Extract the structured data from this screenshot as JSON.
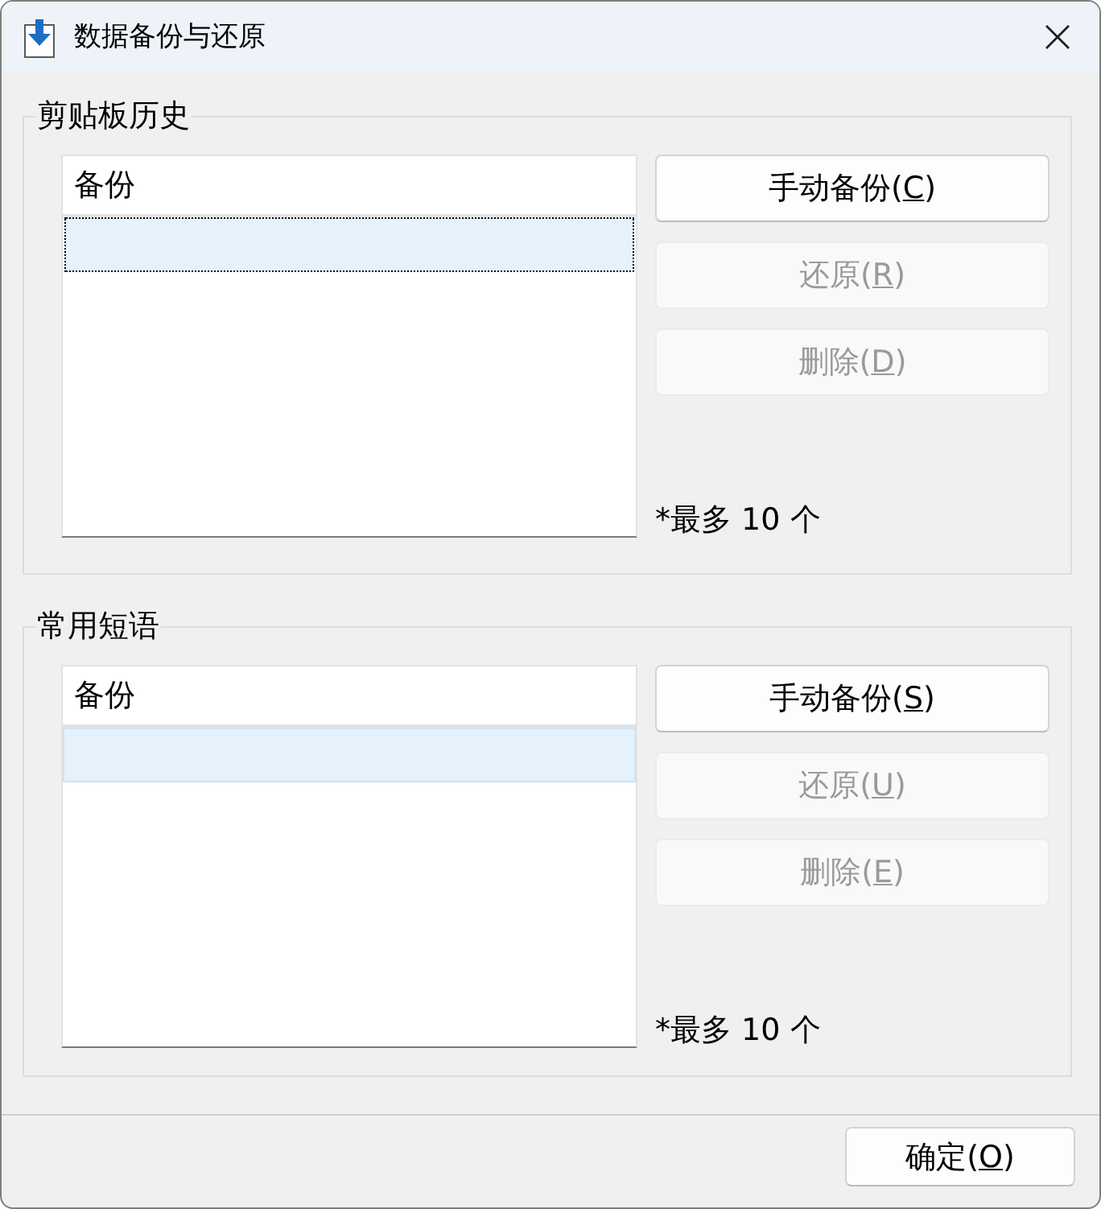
{
  "window": {
    "title": "数据备份与还原"
  },
  "groups": [
    {
      "title": "剪贴板历史",
      "list": {
        "header": "备份",
        "rows": [
          {
            "selected": true,
            "focused": true
          }
        ]
      },
      "buttons": [
        {
          "label": {
            "before": "手动备份(",
            "key": "C",
            "after": ")"
          },
          "disabled": false
        },
        {
          "label": {
            "before": "还原(",
            "key": "R",
            "after": ")"
          },
          "disabled": true
        },
        {
          "label": {
            "before": "删除(",
            "key": "D",
            "after": ")"
          },
          "disabled": true
        }
      ],
      "note": "*最多 10 个"
    },
    {
      "title": "常用短语",
      "list": {
        "header": "备份",
        "rows": [
          {
            "selected": true,
            "focused": false
          }
        ]
      },
      "buttons": [
        {
          "label": {
            "before": "手动备份(",
            "key": "S",
            "after": ")"
          },
          "disabled": false
        },
        {
          "label": {
            "before": "还原(",
            "key": "U",
            "after": ")"
          },
          "disabled": true
        },
        {
          "label": {
            "before": "删除(",
            "key": "E",
            "after": ")"
          },
          "disabled": true
        }
      ],
      "note": "*最多 10 个"
    }
  ],
  "footer": {
    "ok_button": {
      "label": {
        "before": "确定(",
        "key": "O",
        "after": ")"
      }
    }
  }
}
